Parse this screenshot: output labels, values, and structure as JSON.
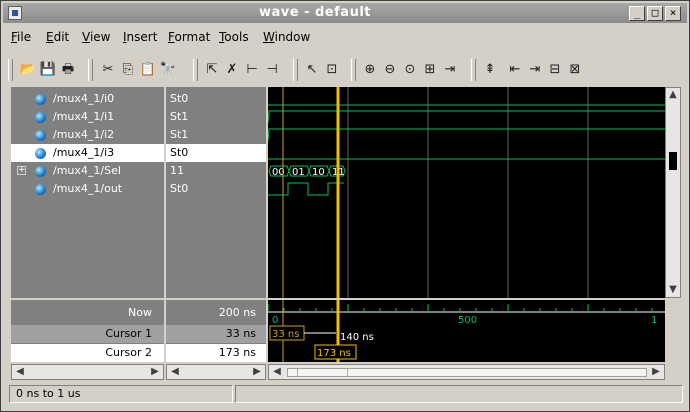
{
  "window": {
    "title": "wave - default",
    "buttons": {
      "minimize": "_",
      "maximize": "□",
      "close": "×"
    }
  },
  "menu": [
    {
      "label": "File",
      "u": "F",
      "rest": "ile"
    },
    {
      "label": "Edit",
      "u": "E",
      "rest": "dit"
    },
    {
      "label": "View",
      "u": "V",
      "rest": "iew"
    },
    {
      "label": "Insert",
      "u": "I",
      "rest": "nsert"
    },
    {
      "label": "Format",
      "u": "F",
      "rest": "ormat"
    },
    {
      "label": "Tools",
      "u": "T",
      "rest": "ools"
    },
    {
      "label": "Window",
      "u": "W",
      "rest": "indow"
    }
  ],
  "toolbar": [
    "open-icon",
    "save-icon",
    "print-icon",
    "cut-icon",
    "copy-icon",
    "paste-icon",
    "find-icon",
    "select-icon",
    "delete-wave-icon",
    "insert-cursor-icon",
    "delete-cursor-icon",
    "pointer-icon",
    "zoom-mode-icon",
    "zoom-in-icon",
    "zoom-out-icon",
    "zoom-full-icon",
    "zoom-cursor-icon",
    "step-icon",
    "find-edge-icon",
    "prev-edge-icon",
    "next-edge-icon",
    "expand-icon",
    "collapse-icon"
  ],
  "signals": [
    {
      "name": "/mux4_1/i0",
      "value": "St0",
      "expandable": false,
      "selected": false
    },
    {
      "name": "/mux4_1/i1",
      "value": "St1",
      "expandable": false,
      "selected": false
    },
    {
      "name": "/mux4_1/i2",
      "value": "St1",
      "expandable": false,
      "selected": false
    },
    {
      "name": "/mux4_1/i3",
      "value": "St0",
      "expandable": false,
      "selected": true
    },
    {
      "name": "/mux4_1/Sel",
      "value": "11",
      "expandable": true,
      "selected": false
    },
    {
      "name": "/mux4_1/out",
      "value": "St0",
      "expandable": false,
      "selected": false
    }
  ],
  "sel_bus_values": [
    "00",
    "01",
    "10",
    "11"
  ],
  "timeline": {
    "now_label": "Now",
    "now_value": "200 ns",
    "cursor1_label": "Cursor 1",
    "cursor1_value": "33 ns",
    "cursor2_label": "Cursor 2",
    "cursor2_value": "173 ns",
    "tick_start": "0",
    "tick_mid": "500",
    "tick_end": "1",
    "cursor1_tag": "33 ns",
    "delta_tag": "140 ns",
    "cursor2_tag": "173 ns"
  },
  "status": {
    "range": "0 ns to 1 us"
  },
  "colors": {
    "wave": "#00c060",
    "cursor": "#f0c000",
    "cursor1": "#c8a020",
    "grid": "#606060",
    "background": "#000000"
  }
}
